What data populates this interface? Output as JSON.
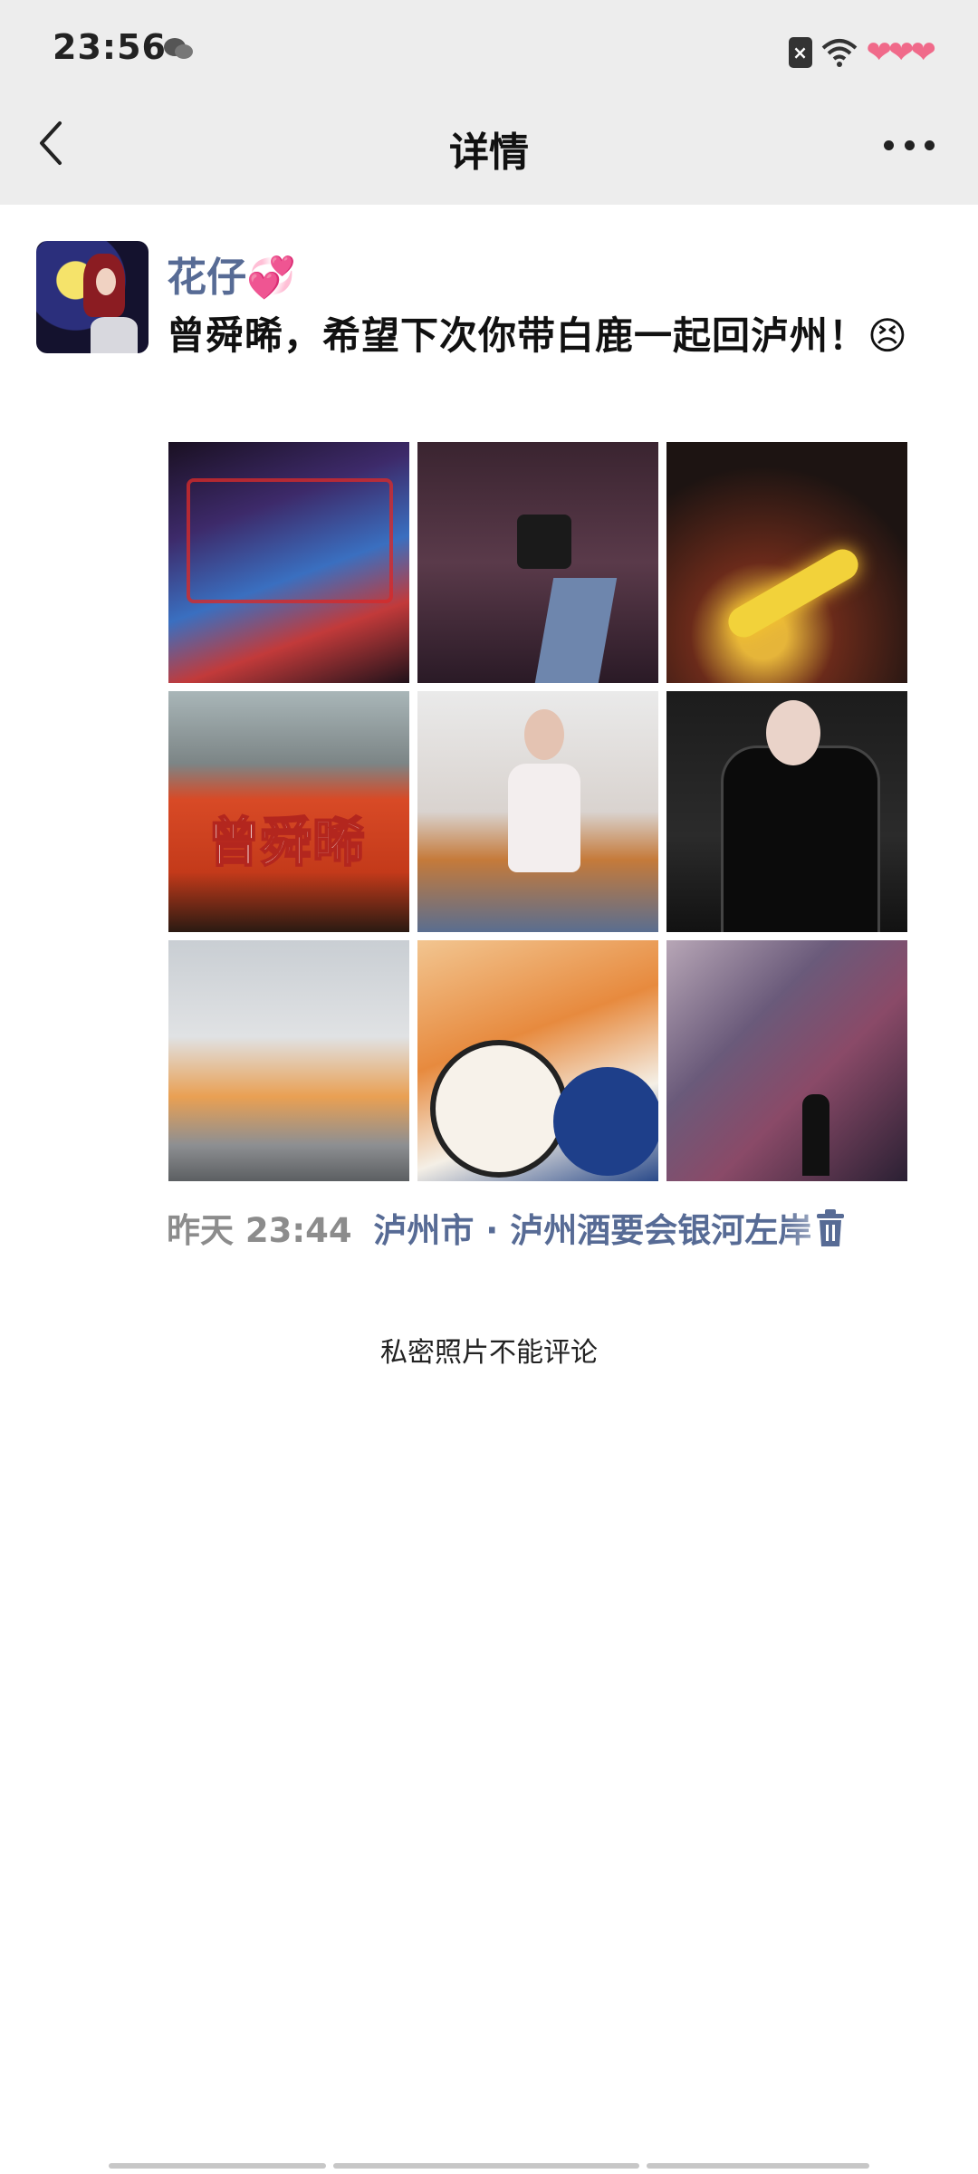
{
  "status_bar": {
    "time": "23:56"
  },
  "nav": {
    "title": "详情"
  },
  "post": {
    "username": "花仔💞",
    "text": "曾舜晞，希望下次你带白鹿一起回泸州！😣",
    "photo_count": 9,
    "photo_4_text": "曾舜晞",
    "time": "昨天 23:44",
    "location": "泸州市 · 泸州酒要会银河左岸"
  },
  "private_note": "私密照片不能评论"
}
